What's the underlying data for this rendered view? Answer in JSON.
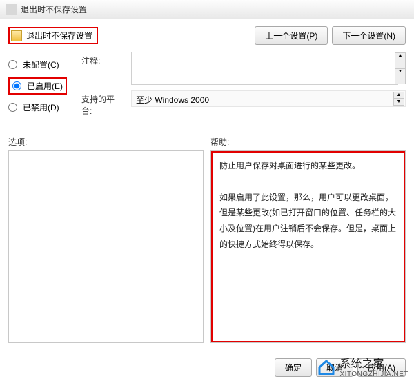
{
  "titlebar": {
    "text": "退出时不保存设置"
  },
  "setting_name": "退出时不保存设置",
  "nav": {
    "prev": "上一个设置(P)",
    "next": "下一个设置(N)"
  },
  "radios": {
    "not_configured": "未配置(C)",
    "enabled": "已启用(E)",
    "disabled": "已禁用(D)"
  },
  "labels": {
    "comment": "注释:",
    "platform": "支持的平台:",
    "options": "选项:",
    "help": "帮助:"
  },
  "platform_value": "至少 Windows 2000",
  "help_text": {
    "p1": "防止用户保存对桌面进行的某些更改。",
    "p2": "如果启用了此设置，那么，用户可以更改桌面，但是某些更改(如已打开窗口的位置、任务栏的大小及位置)在用户注销后不会保存。但是，桌面上的快捷方式始终得以保存。"
  },
  "buttons": {
    "ok": "确定",
    "cancel": "取消",
    "apply": "应用(A)"
  },
  "watermark": {
    "name": "系统之家",
    "url": "XITONGZHIJIA.NET"
  }
}
